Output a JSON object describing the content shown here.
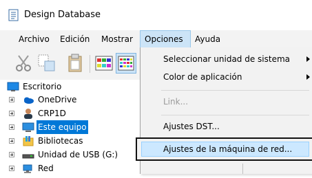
{
  "window": {
    "title": "Design Database",
    "icon": "database-list-icon"
  },
  "menubar": {
    "items": [
      {
        "label": "Archivo"
      },
      {
        "label": "Edición"
      },
      {
        "label": "Mostrar"
      },
      {
        "label": "Opciones",
        "active": true
      },
      {
        "label": "Ayuda"
      }
    ]
  },
  "toolbar": {
    "buttons": [
      {
        "icon": "scissors-icon"
      },
      {
        "icon": "copy-icon"
      },
      {
        "icon": "paste-icon"
      },
      {
        "icon": "large-icons-view-icon"
      },
      {
        "icon": "small-icons-view-icon",
        "pressed": true
      }
    ]
  },
  "tree": {
    "root": {
      "label": "Escritorio",
      "icon": "desktop-icon"
    },
    "items": [
      {
        "label": "OneDrive",
        "icon": "onedrive-icon"
      },
      {
        "label": "CRP1D",
        "icon": "user-icon"
      },
      {
        "label": "Este equipo",
        "icon": "computer-icon",
        "selected": true
      },
      {
        "label": "Bibliotecas",
        "icon": "library-icon"
      },
      {
        "label": "Unidad de USB (G:)",
        "icon": "usb-drive-icon"
      },
      {
        "label": "Red",
        "icon": "network-icon"
      }
    ]
  },
  "dropdown": {
    "items": [
      {
        "label": "Seleccionar unidad de sistema",
        "submenu": true
      },
      {
        "label": "Color de aplicación",
        "submenu": true
      },
      {
        "label": "Link...",
        "disabled": true
      },
      {
        "label": "Ajustes DST..."
      },
      {
        "label": "Ajustes de la máquina de red...",
        "highlighted": true
      }
    ]
  },
  "colors": {
    "selection": "#0078d7",
    "menu_highlight": "#cce8ff",
    "menubar_bg": "#f3f3f3"
  }
}
